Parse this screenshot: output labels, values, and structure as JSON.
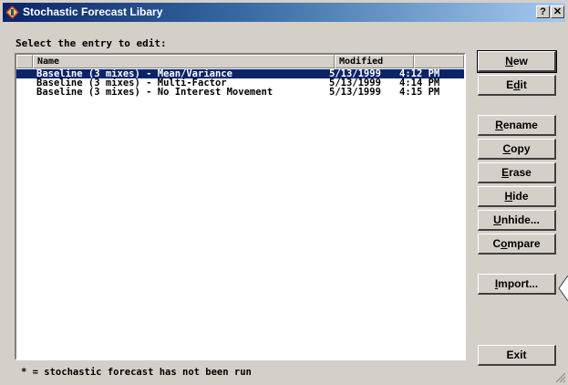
{
  "window": {
    "title": "Stochastic Forecast Libary",
    "help_label": "?",
    "close_label": "✕"
  },
  "prompt": "Select the entry to edit:",
  "list": {
    "columns": {
      "name": "Name",
      "modified": "Modified"
    },
    "rows": [
      {
        "name": "Baseline (3 mixes) - Mean/Variance",
        "date": "5/13/1999",
        "time": "4:12 PM",
        "selected": true
      },
      {
        "name": "Baseline (3 mixes) - Multi-Factor",
        "date": "5/13/1999",
        "time": "4:14 PM",
        "selected": false
      },
      {
        "name": "Baseline (3 mixes) - No Interest Movement",
        "date": "5/13/1999",
        "time": "4:15 PM",
        "selected": false
      }
    ]
  },
  "buttons": {
    "new": {
      "label": "New",
      "accel": "N"
    },
    "edit": {
      "label": "Edit",
      "accel": "d"
    },
    "rename": {
      "label": "Rename",
      "accel": "R"
    },
    "copy": {
      "label": "Copy",
      "accel": "C"
    },
    "erase": {
      "label": "Erase",
      "accel": "E"
    },
    "hide": {
      "label": "Hide",
      "accel": "H"
    },
    "unhide": {
      "label": "Unhide...",
      "accel": "U"
    },
    "compare": {
      "label": "Compare",
      "accel": "o"
    },
    "import": {
      "label": "Import...",
      "accel": "I"
    },
    "exit": {
      "label": "Exit",
      "accel": ""
    }
  },
  "footer": "* = stochastic forecast has not been run",
  "icons": {
    "app": "app-icon",
    "grip": "resize-grip-icon"
  },
  "colors": {
    "titlebar_start": "#0a246a",
    "titlebar_end": "#a6caf0",
    "selection": "#0a246a",
    "face": "#d4d0c8"
  }
}
